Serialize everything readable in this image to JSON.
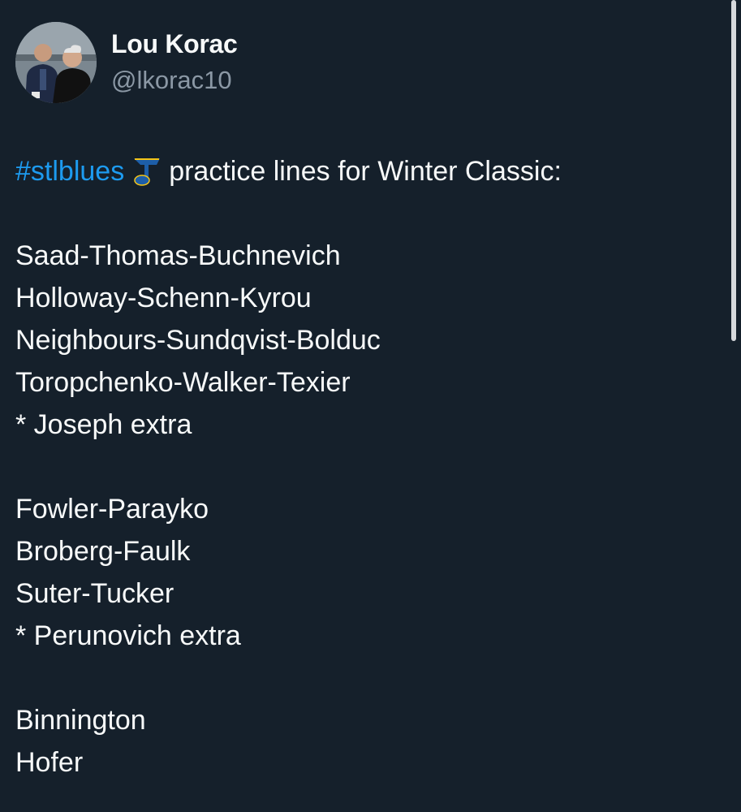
{
  "author": {
    "display_name": "Lou Korac",
    "handle": "@lkorac10"
  },
  "tweet": {
    "hashtag": "#stlblues",
    "emoji_icon": "blues-note-icon",
    "intro_text": "practice lines for Winter Classic:",
    "forwards": [
      "Saad-Thomas-Buchnevich",
      "Holloway-Schenn-Kyrou",
      "Neighbours-Sundqvist-Bolduc",
      "Toropchenko-Walker-Texier",
      "* Joseph extra"
    ],
    "defense": [
      "Fowler-Parayko",
      "Broberg-Faulk",
      "Suter-Tucker",
      "* Perunovich extra"
    ],
    "goalies": [
      "Binnington",
      "Hofer"
    ]
  },
  "colors": {
    "background": "#15202b",
    "text": "#f7f9f9",
    "secondary_text": "#8b98a5",
    "link": "#1d9bf0",
    "note_blue": "#1d5ea8",
    "note_yellow": "#f5c518"
  }
}
